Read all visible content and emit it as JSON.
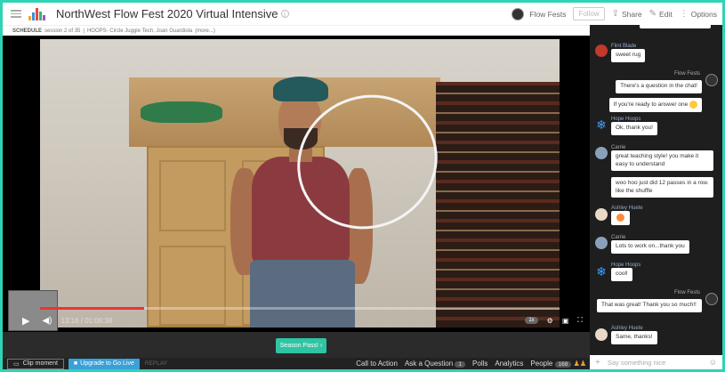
{
  "header": {
    "title": "NorthWest Flow Fest 2020 Virtual Intensive",
    "org_name": "Flow Fests",
    "follow_label": "Follow",
    "share_label": "Share",
    "edit_label": "Edit",
    "options_label": "Options"
  },
  "schedule": {
    "label": "SCHEDULE",
    "session": "session 2 of 35",
    "session_title": "HOOPS- Circle Juggle Tech, Joan Guardiola",
    "more": "(more...)"
  },
  "player": {
    "time": "13:16 / 01:06:38",
    "speed": "1x",
    "progress": 0.2
  },
  "season_pass_label": "Season Pass!",
  "footer": {
    "clip_label": "Clip moment",
    "upgrade_label": "Upgrade to Go Live",
    "replay_label": "REPLAY",
    "cta_label": "Call to Action",
    "ask_label": "Ask a Question",
    "ask_count": "1",
    "polls_label": "Polls",
    "analytics_label": "Analytics",
    "people_label": "People",
    "people_count": "168"
  },
  "chat": {
    "messages": [
      {
        "author": "Flint Blade",
        "lines": [
          "sweet rug"
        ]
      },
      {
        "author": "Flow Fests",
        "lines": [
          "There's a question in the chat!",
          "If you're ready to answer one"
        ]
      },
      {
        "author": "Hope Hoops",
        "lines": [
          "Ok, thank you!"
        ]
      },
      {
        "author": "Carrie",
        "lines": [
          "great teaching style! you make it easy to understand",
          "woo hoo just did 12 passes in a row. like the shuffle"
        ]
      },
      {
        "author": "Ashley Huete",
        "lines": [
          ""
        ]
      },
      {
        "author": "Carrie",
        "lines": [
          "Lots to work on...thank you"
        ]
      },
      {
        "author": "Hope Hoops",
        "lines": [
          "cool!"
        ]
      },
      {
        "author": "Flow Fests",
        "lines": [
          "That was great! Thank you so much!!"
        ]
      },
      {
        "author": "Ashley Huete",
        "lines": [
          "Same, thanks!"
        ]
      }
    ],
    "input_placeholder": "Say something nice"
  },
  "colors": {
    "accent": "#2fd3b5",
    "upgrade": "#3aa0d8",
    "season_pass": "#2fc4a3"
  }
}
